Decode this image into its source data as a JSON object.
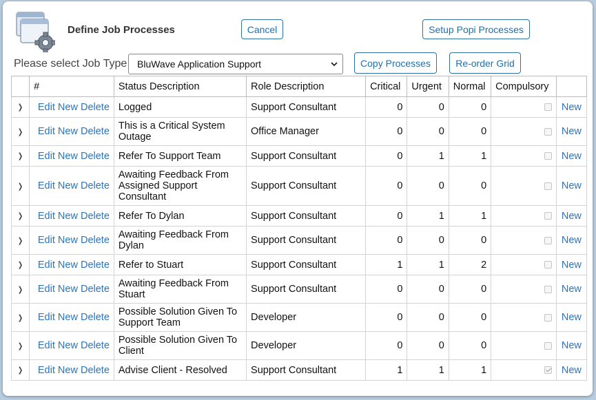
{
  "header": {
    "title": "Define Job Processes",
    "cancel_label": "Cancel",
    "setup_label": "Setup Popi Processes"
  },
  "job_type": {
    "label": "Please select Job Type",
    "selected": "BluWave Application Support",
    "copy_label": "Copy Processes",
    "reorder_label": "Re-order Grid"
  },
  "grid": {
    "columns": [
      "#",
      "Status Description",
      "Role Description",
      "Critical",
      "Urgent",
      "Normal",
      "Compulsory"
    ],
    "action_labels": {
      "edit": "Edit",
      "new": "New",
      "delete": "Delete",
      "row_new": "New"
    },
    "rows": [
      {
        "status": "Logged",
        "role": "Support Consultant",
        "critical": "0",
        "urgent": "0",
        "normal": "0",
        "compulsory": false
      },
      {
        "status": "This is a Critical System Outage",
        "role": "Office Manager",
        "critical": "0",
        "urgent": "0",
        "normal": "0",
        "compulsory": false
      },
      {
        "status": "Refer To Support Team",
        "role": "Support Consultant",
        "critical": "0",
        "urgent": "1",
        "normal": "1",
        "compulsory": false
      },
      {
        "status": "Awaiting Feedback From Assigned Support Consultant",
        "role": "Support Consultant",
        "critical": "0",
        "urgent": "0",
        "normal": "0",
        "compulsory": false
      },
      {
        "status": "Refer To Dylan",
        "role": "Support Consultant",
        "critical": "0",
        "urgent": "1",
        "normal": "1",
        "compulsory": false
      },
      {
        "status": "Awaiting Feedback From Dylan",
        "role": "Support Consultant",
        "critical": "0",
        "urgent": "0",
        "normal": "0",
        "compulsory": false
      },
      {
        "status": "Refer to Stuart",
        "role": "Support Consultant",
        "critical": "1",
        "urgent": "1",
        "normal": "2",
        "compulsory": false
      },
      {
        "status": "Awaiting Feedback From Stuart",
        "role": "Support Consultant",
        "critical": "0",
        "urgent": "0",
        "normal": "0",
        "compulsory": false
      },
      {
        "status": "Possible Solution Given To Support Team",
        "role": "Developer",
        "critical": "0",
        "urgent": "0",
        "normal": "0",
        "compulsory": false
      },
      {
        "status": "Possible Solution Given To Client",
        "role": "Developer",
        "critical": "0",
        "urgent": "0",
        "normal": "0",
        "compulsory": false
      },
      {
        "status": "Advise Client - Resolved",
        "role": "Support Consultant",
        "critical": "1",
        "urgent": "1",
        "normal": "1",
        "compulsory": true
      }
    ]
  },
  "icons": {
    "app": "window-gear-icon",
    "expand": "chevron-right-icon",
    "dropdown": "chevron-down-icon"
  },
  "colors": {
    "link": "#2e73b8",
    "button_border": "#2c6fa3",
    "background": "#b9cde0"
  }
}
